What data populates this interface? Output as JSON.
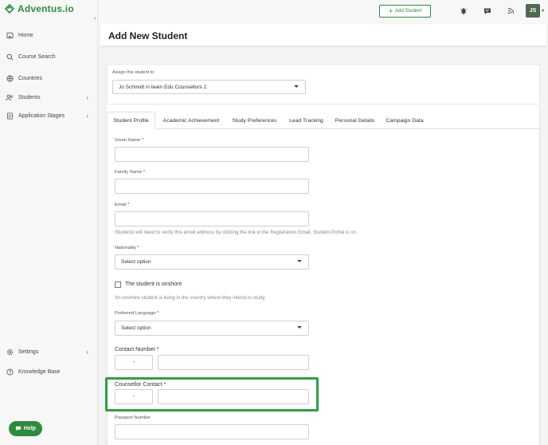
{
  "app": {
    "name": "Adventus.io"
  },
  "sidebar": {
    "items": [
      {
        "label": "Home",
        "icon": "home-icon"
      },
      {
        "label": "Course Search",
        "icon": "search-icon"
      },
      {
        "label": "Countries",
        "icon": "globe-icon"
      },
      {
        "label": "Students",
        "icon": "users-icon",
        "has_submenu": true
      },
      {
        "label": "Application Stages",
        "icon": "document-icon",
        "has_submenu": true
      },
      {
        "label": "Settings",
        "icon": "gear-icon",
        "has_submenu": true
      },
      {
        "label": "Knowledge Base",
        "icon": "question-icon"
      }
    ],
    "help_label": "Help"
  },
  "topbar": {
    "add_student_label": "Add Student",
    "avatar_initials": "JS"
  },
  "page": {
    "title": "Add New Student"
  },
  "assign": {
    "label": "Assign this student to",
    "value": "Jo Schmidt in team Edu Counsellors 2"
  },
  "tabs": [
    {
      "label": "Student Profile",
      "active": true
    },
    {
      "label": "Academic Achievement"
    },
    {
      "label": "Study Preferences"
    },
    {
      "label": "Lead Tracking"
    },
    {
      "label": "Personal Details"
    },
    {
      "label": "Campaign Data"
    }
  ],
  "form": {
    "given_name_label": "Given Name *",
    "family_name_label": "Family Name *",
    "email_label": "Email *",
    "email_hint": "Students will need to verify this email address by clicking the link in the Registration Email. Student Portal is on.",
    "nationality_label": "Nationality *",
    "nationality_value": "Select option",
    "onshore_label": "The student is onshore",
    "onshore_hint": "An onshore student is living in the country where they intend to study.",
    "language_label": "Preferred Language *",
    "language_value": "Select option",
    "contact_label": "Contact Number *",
    "contact_code": "-",
    "counsellor_label": "Counsellor Contact *",
    "counsellor_code": "-",
    "passport_label": "Passport Number"
  },
  "colors": {
    "brand": "#2e8b3e",
    "highlight": "#2ea043"
  }
}
